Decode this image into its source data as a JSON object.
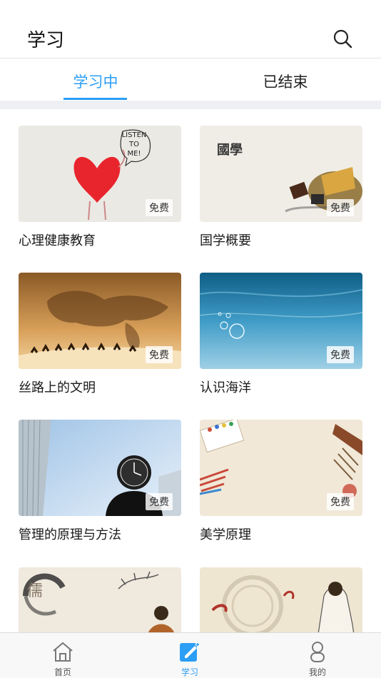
{
  "header": {
    "title": "学习"
  },
  "tabs": [
    {
      "label": "学习中",
      "active": true
    },
    {
      "label": "已结束",
      "active": false
    }
  ],
  "courses": [
    {
      "title": "心理健康教育",
      "badge": "免费",
      "image_text": [
        "LISTEN",
        "TO",
        "ME!"
      ]
    },
    {
      "title": "国学概要",
      "badge": "免费",
      "image_text": [
        "國學"
      ]
    },
    {
      "title": "丝路上的文明",
      "badge": "免费"
    },
    {
      "title": "认识海洋",
      "badge": "免费"
    },
    {
      "title": "管理的原理与方法",
      "badge": "免费"
    },
    {
      "title": "美学原理",
      "badge": "免费"
    },
    {
      "title": "",
      "badge": "",
      "image_text": [
        "儒"
      ]
    },
    {
      "title": "",
      "badge": ""
    }
  ],
  "tabbar": [
    {
      "label": "首页",
      "icon": "home-icon",
      "active": false
    },
    {
      "label": "学习",
      "icon": "pencil-icon",
      "active": true
    },
    {
      "label": "我的",
      "icon": "user-icon",
      "active": false
    }
  ],
  "colors": {
    "accent": "#2b9ef5",
    "divider": "#eef0f4"
  }
}
